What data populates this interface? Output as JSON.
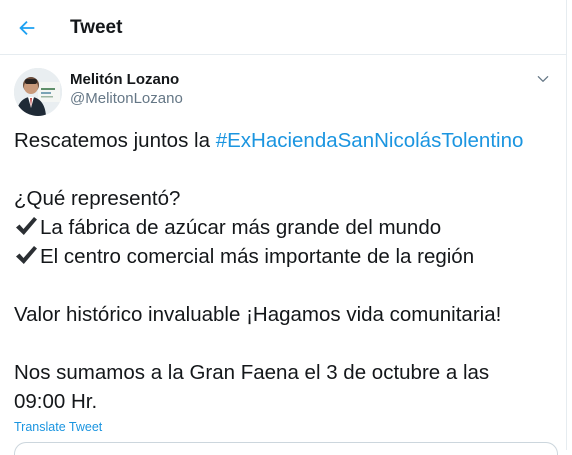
{
  "header": {
    "title": "Tweet",
    "back_icon": "arrow-left-icon",
    "accent": "#1da1f2"
  },
  "author": {
    "name": "Melitón Lozano",
    "handle": "@MelitonLozano",
    "caret_icon": "chevron-down-icon"
  },
  "tweet": {
    "line1_prefix": "Rescatemos juntos la ",
    "hashtag": "#ExHaciendaSanNicolásTolentino",
    "question": "¿Qué representó?",
    "check_icon": "heavy-check-mark-icon",
    "bullet1": "La fábrica de azúcar más grande del mundo",
    "bullet2": "El centro comercial más importante de la región",
    "value_line": "Valor histórico invaluable ¡Hagamos vida comunitaria!",
    "closing_line1": "Nos sumamos a la Gran Faena el 3 de octubre a las",
    "closing_line2": "09:00 Hr.",
    "translate": "Translate Tweet"
  },
  "colors": {
    "text": "#14171a",
    "muted": "#657786",
    "link": "#1b95e0",
    "border": "#e6ecf0"
  }
}
